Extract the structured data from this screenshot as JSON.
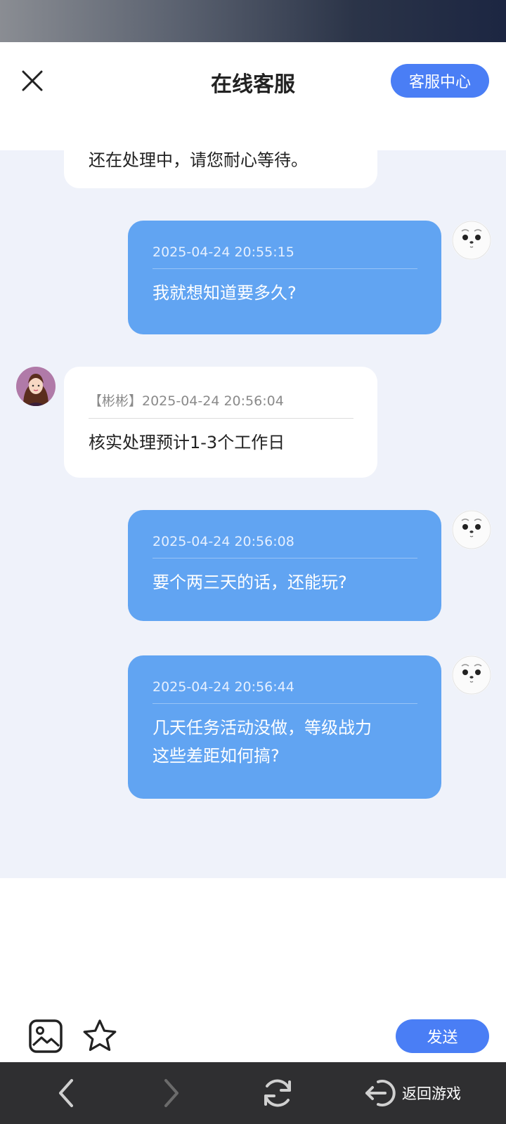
{
  "header": {
    "title": "在线客服",
    "service_center_label": "客服中心"
  },
  "messages": [
    {
      "role": "agent",
      "meta": "",
      "text": "还在处理中，请您耐心等待。"
    },
    {
      "role": "user",
      "meta": "2025-04-24 20:55:15",
      "text": "我就想知道要多久?"
    },
    {
      "role": "agent",
      "meta": "【彬彬】2025-04-24 20:56:04",
      "text": "核实处理预计1-3个工作日"
    },
    {
      "role": "user",
      "meta": "2025-04-24 20:56:08",
      "text": "要个两三天的话，还能玩?"
    },
    {
      "role": "user",
      "meta": "2025-04-24 20:56:44",
      "text_lines": [
        "几天任务活动没做，等级战力",
        "这些差距如何搞?"
      ]
    }
  ],
  "composer": {
    "send_label": "发送"
  },
  "nav": {
    "return_game_label": "返回游戏"
  },
  "colors": {
    "accent": "#4a7ef5",
    "user_bubble": "#61a4f2",
    "chat_bg": "#eff2fa",
    "nav_bg": "#2f2f31"
  }
}
